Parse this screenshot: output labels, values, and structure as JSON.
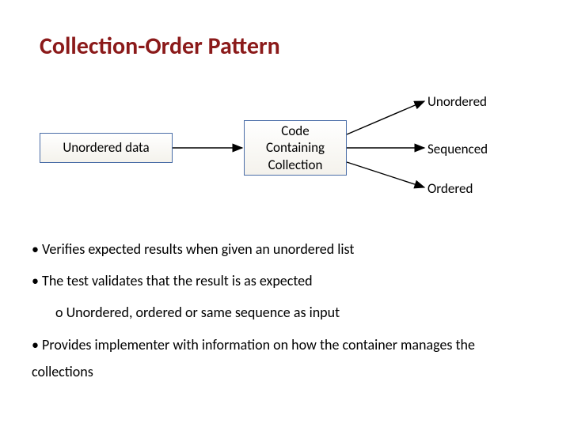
{
  "title": "Collection-Order Pattern",
  "diagram": {
    "input_label": "Unordered data",
    "process_label": "Code\nContaining\nCollection",
    "outputs": {
      "unordered": "Unordered",
      "sequenced": "Sequenced",
      "ordered": "Ordered"
    }
  },
  "bullets": {
    "b1": "Verifies expected results when given an unordered list",
    "b2": "The test validates that the result is as expected",
    "b2_sub": "Unordered, ordered or same sequence as input",
    "b3": "Provides implementer with information on how the container manages the collections"
  }
}
